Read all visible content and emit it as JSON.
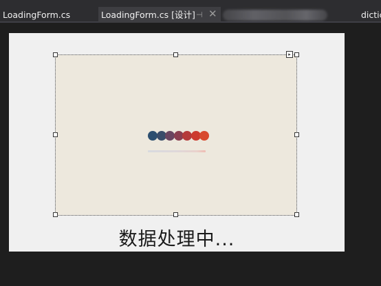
{
  "tabs": [
    {
      "label": "LoadingForm.cs"
    },
    {
      "label": "LoadingForm.cs [设计]",
      "pin_glyph": "⊣",
      "close_glyph": "✕"
    },
    {
      "label": "dictic"
    }
  ],
  "designer": {
    "status_text": "数据处理中...",
    "smart_tag_glyph": "▸"
  },
  "loader_dots": [
    "#2d4f70",
    "#3a4d6a",
    "#6a4560",
    "#8a3e50",
    "#b53a3a",
    "#cc3a2e",
    "#d84a2e"
  ]
}
